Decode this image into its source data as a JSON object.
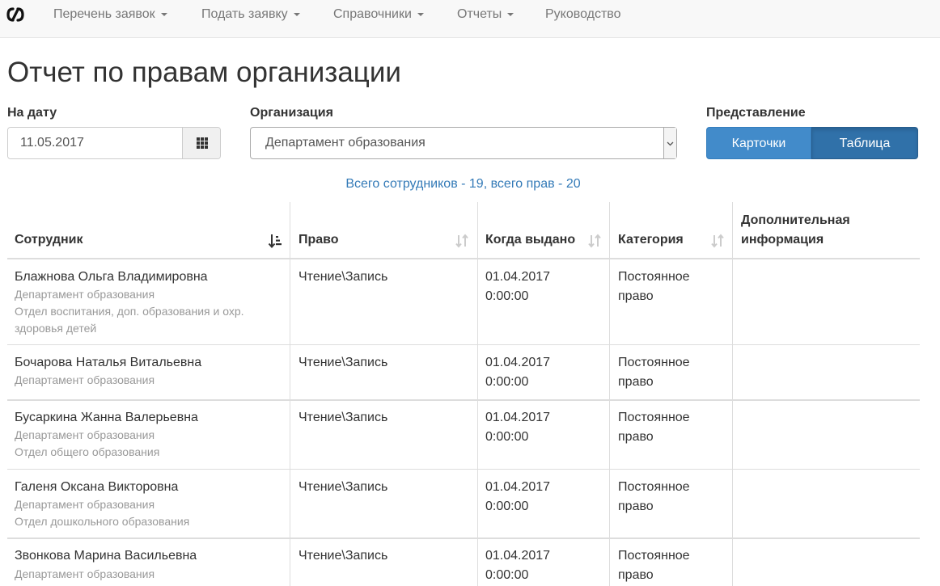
{
  "nav": {
    "items": [
      {
        "label": "Перечень заявок",
        "dropdown": true
      },
      {
        "label": "Подать заявку",
        "dropdown": true
      },
      {
        "label": "Справочники",
        "dropdown": true
      },
      {
        "label": "Отчеты",
        "dropdown": true
      },
      {
        "label": "Руководство",
        "dropdown": false
      }
    ]
  },
  "page": {
    "title": "Отчет по правам организации"
  },
  "filters": {
    "date_label": "На дату",
    "date_value": "11.05.2017",
    "org_label": "Организация",
    "org_value": "Департамент образования",
    "view_label": "Представление",
    "view_cards": "Карточки",
    "view_table": "Таблица",
    "view_selected": "Таблица"
  },
  "summary": "Всего сотрудников - 19, всего прав - 20",
  "table": {
    "headers": {
      "employee": "Сотрудник",
      "right": "Право",
      "issued": "Когда выдано",
      "category": "Категория",
      "extra_1": "Дополнительная",
      "extra_2": "информация"
    },
    "rows": [
      {
        "name": "Блажнова Ольга Владимировна",
        "org": "Департамент образования",
        "dept_1": "Отдел воспитания, доп. образования и охр.",
        "dept_2": "здоровья детей",
        "right": "Чтение\\Запись",
        "date": "01.04.2017",
        "time": "0:00:00",
        "cat_1": "Постоянное",
        "cat_2": "право",
        "extra": ""
      },
      {
        "name": "Бочарова Наталья Витальевна",
        "org": "Департамент образования",
        "right": "Чтение\\Запись",
        "date": "01.04.2017",
        "time": "0:00:00",
        "cat_1": "Постоянное",
        "cat_2": "право",
        "extra": ""
      },
      {
        "name": "Бусаркина Жанна Валерьевна",
        "org": "Департамент образования",
        "dept_1": "Отдел общего образования",
        "right": "Чтение\\Запись",
        "date": "01.04.2017",
        "time": "0:00:00",
        "cat_1": "Постоянное",
        "cat_2": "право",
        "extra": ""
      },
      {
        "name": "Галеня Оксана Викторовна",
        "org": "Департамент образования",
        "dept_1": "Отдел дошкольного образования",
        "right": "Чтение\\Запись",
        "date": "01.04.2017",
        "time": "0:00:00",
        "cat_1": "Постоянное",
        "cat_2": "право",
        "extra": ""
      },
      {
        "name": "Звонкова Марина Васильевна",
        "org": "Департамент образования",
        "right": "Чтение\\Запись",
        "date": "01.04.2017",
        "time": "0:00:00",
        "cat_1": "Постоянное",
        "cat_2": "право",
        "extra": ""
      }
    ]
  },
  "colors": {
    "primary": "#428bca",
    "primary_active": "#3071a9",
    "link": "#337ab7",
    "muted": "#999999"
  }
}
